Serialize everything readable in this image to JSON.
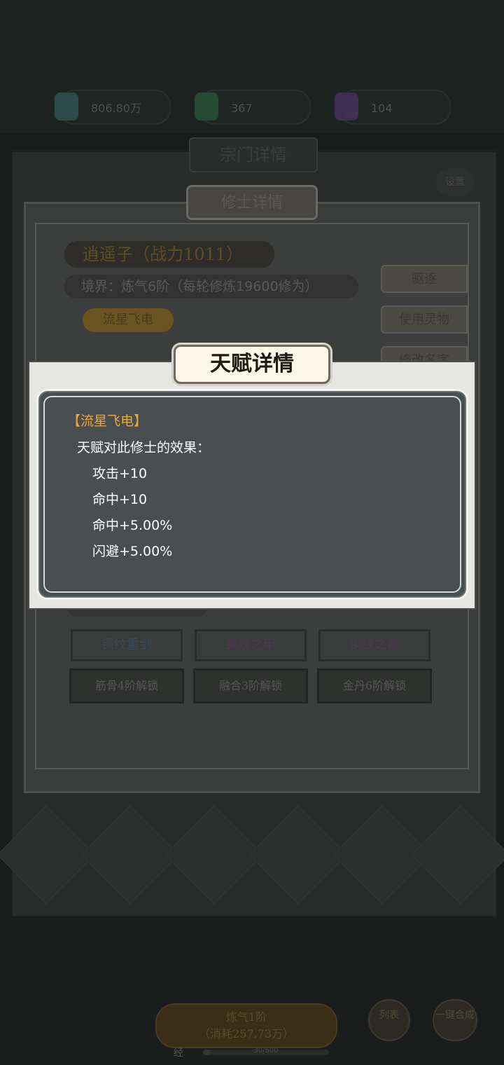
{
  "resources": [
    {
      "value": "806.80万",
      "sub": "灵石",
      "icon": "spirit-stone-icon",
      "color": "#2d4a4a"
    },
    {
      "value": "367",
      "sub": "灵草",
      "icon": "herb-icon",
      "color": "#244a33"
    },
    {
      "value": "104",
      "sub": "天髓",
      "icon": "essence-icon",
      "color": "#3f2d52"
    }
  ],
  "sect": {
    "title": "宗门详情",
    "mini_button": "设置"
  },
  "cultivator": {
    "panel_title": "修士详情",
    "name_line": "逍遥子（战力1011）",
    "realm_line": "境界：炼气6阶（每轮修炼19600修为）",
    "talent_chip": "流星飞电",
    "actions": [
      "驱逐",
      "使用灵物",
      "修改名字"
    ],
    "equipment": [
      {
        "label": "铜纹重剑",
        "color": "#36485a"
      },
      {
        "label": "铜纹之甲",
        "color": "#4a3a4e"
      },
      {
        "label": "铜纹之靴",
        "color": "#4a3a4e"
      }
    ],
    "unlocks": [
      "筋骨4阶解锁",
      "融合3阶解锁",
      "金丹6阶解锁"
    ]
  },
  "dialog": {
    "title": "天赋详情",
    "talent_name": "【流星飞电】",
    "effect_header": "天赋对此修士的效果：",
    "effects": [
      "攻击+10",
      "命中+10",
      "命中+5.00%",
      "闪避+5.00%"
    ]
  },
  "bottom": {
    "main_button_line1": "炼气1阶",
    "main_button_line2": "（消耗257.73万）",
    "list_button": "列表",
    "merge_button": "一键合成",
    "progress_label": "经",
    "progress_text": "30/500",
    "progress": 0.06
  }
}
